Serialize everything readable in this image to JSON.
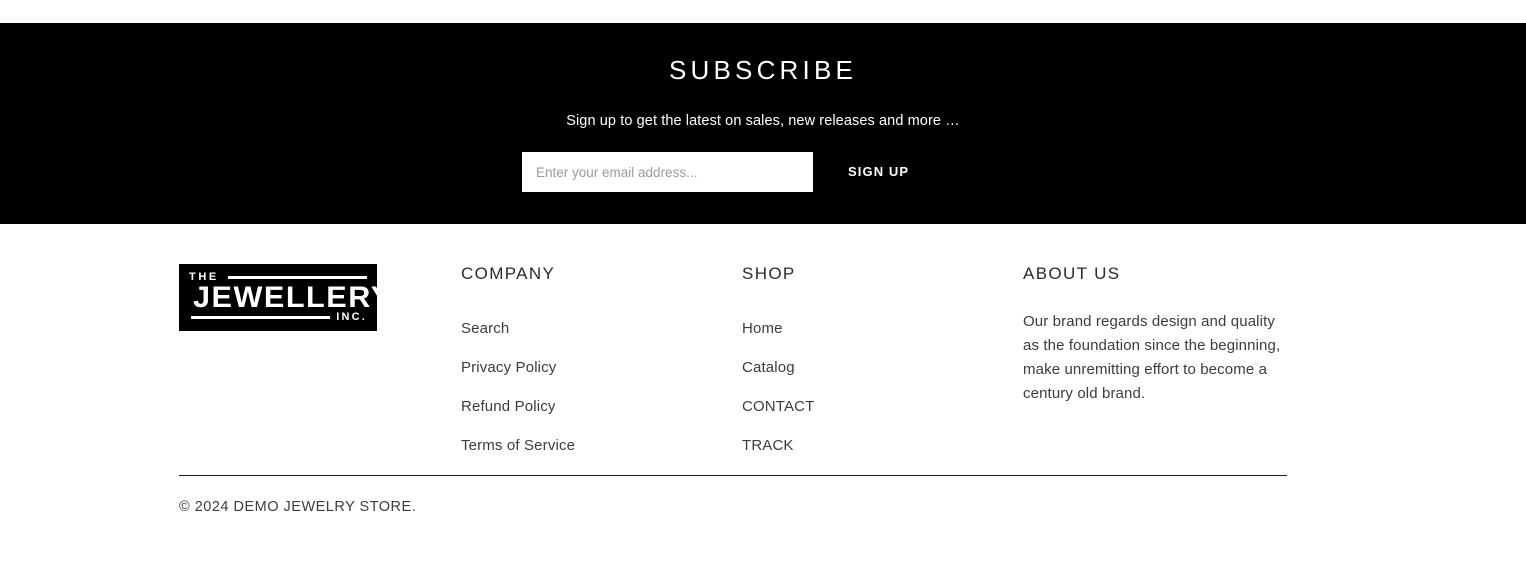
{
  "colors": {
    "band_background": "#000000",
    "page_background": "#ffffff",
    "text_light": "#ffffff",
    "text_dark": "#3c3c3c",
    "divider": "#1c1c1c"
  },
  "subscribe": {
    "title": "SUBSCRIBE",
    "subtitle": "Sign up to get the latest on sales, new releases and more …",
    "email_placeholder": "Enter your email address...",
    "email_value": "",
    "signup_label": "SIGN UP"
  },
  "footer": {
    "logo": {
      "top_word": "THE",
      "main_word": "JEWELLERY",
      "suffix_word": "INC."
    },
    "columns": [
      {
        "title": "COMPANY",
        "links": [
          {
            "label": "Search"
          },
          {
            "label": "Privacy Policy"
          },
          {
            "label": "Refund Policy"
          },
          {
            "label": "Terms of Service"
          }
        ]
      },
      {
        "title": "SHOP",
        "links": [
          {
            "label": "Home"
          },
          {
            "label": "Catalog"
          },
          {
            "label": "CONTACT"
          },
          {
            "label": "TRACK"
          }
        ]
      }
    ],
    "about": {
      "title": "ABOUT US",
      "body": "Our brand regards design and quality as the foundation since the beginning, make unremitting effort to become a century old brand."
    },
    "copyright": "© 2024 DEMO JEWELRY STORE."
  }
}
